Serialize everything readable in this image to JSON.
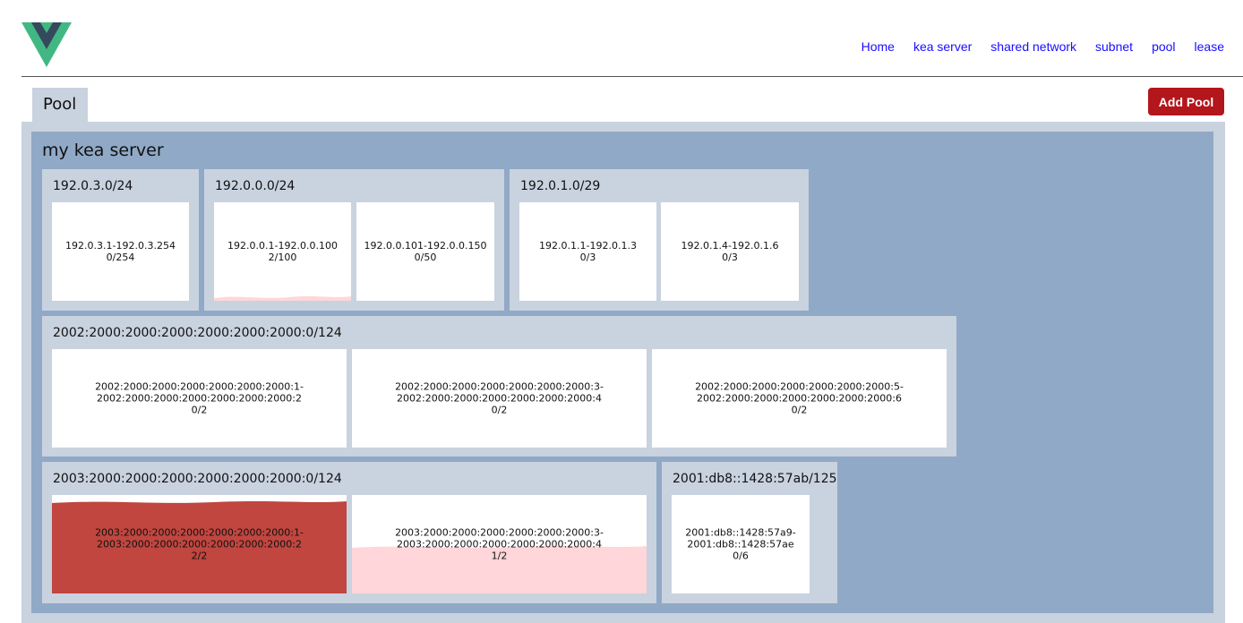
{
  "nav": {
    "items": [
      {
        "label": "Home"
      },
      {
        "label": "kea server"
      },
      {
        "label": "shared network"
      },
      {
        "label": "subnet"
      },
      {
        "label": "pool"
      },
      {
        "label": "lease"
      }
    ]
  },
  "page": {
    "tab_label": "Pool",
    "add_button_label": "Add Pool"
  },
  "server": {
    "name": "my kea server",
    "subnets": [
      {
        "cidr": "192.0.3.0/24",
        "pools": [
          {
            "range_start": "192.0.3.1",
            "range_end": "192.0.3.254",
            "range": "192.0.3.1-192.0.3.254",
            "usage": "0/254",
            "utilization": 0
          }
        ]
      },
      {
        "cidr": "192.0.0.0/24",
        "pools": [
          {
            "range": "192.0.0.1-192.0.0.100",
            "usage": "2/100",
            "utilization": 0.02
          },
          {
            "range": "192.0.0.101-192.0.0.150",
            "usage": "0/50",
            "utilization": 0
          }
        ]
      },
      {
        "cidr": "192.0.1.0/29",
        "pools": [
          {
            "range": "192.0.1.1-192.0.1.3",
            "usage": "0/3",
            "utilization": 0
          },
          {
            "range": "192.0.1.4-192.0.1.6",
            "usage": "0/3",
            "utilization": 0
          }
        ]
      },
      {
        "cidr": "2002:2000:2000:2000:2000:2000:2000:0/124",
        "pools": [
          {
            "range_start": "2002:2000:2000:2000:2000:2000:2000:1-",
            "range_end": "2002:2000:2000:2000:2000:2000:2000:2",
            "usage": "0/2",
            "utilization": 0
          },
          {
            "range_start": "2002:2000:2000:2000:2000:2000:2000:3-",
            "range_end": "2002:2000:2000:2000:2000:2000:2000:4",
            "usage": "0/2",
            "utilization": 0
          },
          {
            "range_start": "2002:2000:2000:2000:2000:2000:2000:5-",
            "range_end": "2002:2000:2000:2000:2000:2000:2000:6",
            "usage": "0/2",
            "utilization": 0
          }
        ]
      },
      {
        "cidr": "2003:2000:2000:2000:2000:2000:2000:0/124",
        "pools": [
          {
            "range_start": "2003:2000:2000:2000:2000:2000:2000:1-",
            "range_end": "2003:2000:2000:2000:2000:2000:2000:2",
            "usage": "2/2",
            "utilization": 1.0
          },
          {
            "range_start": "2003:2000:2000:2000:2000:2000:2000:3-",
            "range_end": "2003:2000:2000:2000:2000:2000:2000:4",
            "usage": "1/2",
            "utilization": 0.5
          }
        ]
      },
      {
        "cidr": "2001:db8::1428:57ab/125",
        "pools": [
          {
            "range_start": "2001:db8::1428:57a9-",
            "range_end": "2001:db8::1428:57ae",
            "usage": "0/6",
            "utilization": 0
          }
        ]
      }
    ]
  },
  "colors": {
    "accent_button": "#b3161b",
    "full_utilization": "#c0463f",
    "partial_utilization": "#ffd6d9",
    "server_bg": "#90a9c6",
    "subnet_bg": "#c9d2df",
    "nav_link": "#1a0dff",
    "logo_green": "#41b883",
    "logo_dark": "#35495e"
  },
  "icons": {
    "logo": "vue-logo-icon"
  }
}
